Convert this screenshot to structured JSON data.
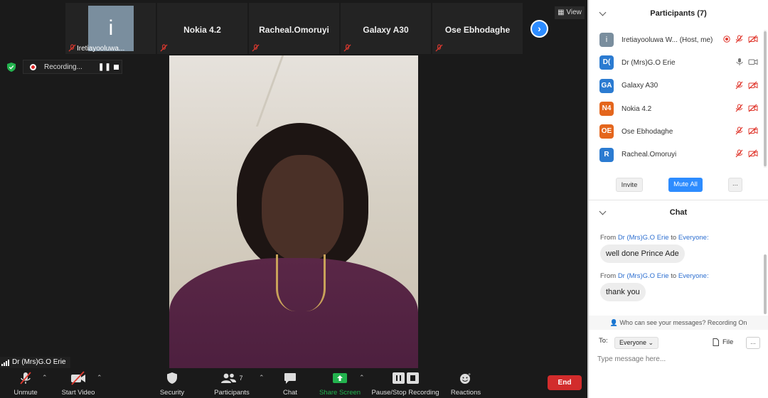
{
  "gallery": {
    "self_tile": {
      "avatar_letter": "i",
      "name": "Iretiayooluwa..."
    },
    "tiles": [
      {
        "name": "Nokia 4.2"
      },
      {
        "name": "Racheal.Omoruyi"
      },
      {
        "name": "Galaxy A30"
      },
      {
        "name": "Ose Ebhodaghe"
      }
    ],
    "view_label": "View"
  },
  "recording": {
    "label": "Recording...",
    "pause_glyph": "❚❚"
  },
  "active_speaker": {
    "name": "Dr (Mrs)G.O Erie"
  },
  "toolbar": {
    "unmute": "Unmute",
    "start_video": "Start Video",
    "security": "Security",
    "participants": "Participants",
    "participants_count": "7",
    "chat": "Chat",
    "share_screen": "Share Screen",
    "recording": "Pause/Stop Recording",
    "reactions": "Reactions",
    "end": "End"
  },
  "participants_panel": {
    "title": "Participants (7)",
    "list": [
      {
        "initials": "i",
        "name": "Iretiayooluwa W...  (Host, me)",
        "color": "#7a8e9e"
      },
      {
        "initials": "D(",
        "name": "Dr (Mrs)G.O Erie",
        "color": "#2b7bd1"
      },
      {
        "initials": "GA",
        "name": "Galaxy A30",
        "color": "#2b7bd1"
      },
      {
        "initials": "N4",
        "name": "Nokia 4.2",
        "color": "#e4661d"
      },
      {
        "initials": "OE",
        "name": "Ose Ebhodaghe",
        "color": "#e4661d"
      },
      {
        "initials": "R",
        "name": "Racheal.Omoruyi",
        "color": "#2b7bd1"
      }
    ],
    "invite": "Invite",
    "mute_all": "Mute All",
    "more": "..."
  },
  "chat_panel": {
    "title": "Chat",
    "messages": [
      {
        "from_prefix": "From",
        "from": "Dr (Mrs)G.O Erie",
        "to_prefix": "to",
        "to": "Everyone:",
        "text": "well done Prince Ade"
      },
      {
        "from_prefix": "From",
        "from": "Dr (Mrs)G.O Erie",
        "to_prefix": "to",
        "to": "Everyone:",
        "text": "thank you"
      }
    ],
    "visibility_note": "Who can see your messages? Recording On",
    "to_label": "To:",
    "to_value": "Everyone",
    "file_label": "File",
    "more_label": "...",
    "input_placeholder": "Type message here..."
  },
  "colors": {
    "accent": "#2d8cff",
    "end": "#d22c2c",
    "share": "#23b34e",
    "muted": "#e0392f"
  }
}
